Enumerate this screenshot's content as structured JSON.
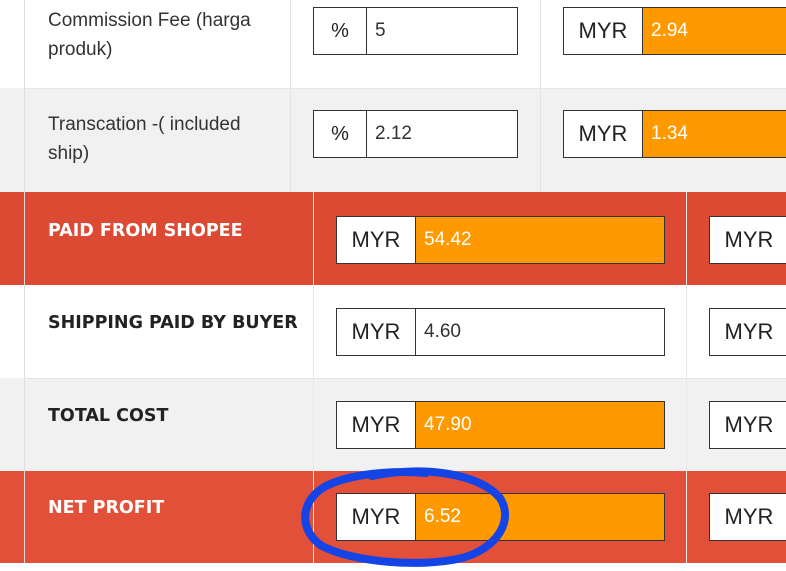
{
  "rows": {
    "commission": {
      "label": "Commission Fee (harga produk)",
      "percent_prefix": "%",
      "percent_value": "5",
      "currency": "MYR",
      "amount": "2.94"
    },
    "transaction": {
      "label": "Transcation -( included ship)",
      "percent_prefix": "%",
      "percent_value": "2.12",
      "currency": "MYR",
      "amount": "1.34"
    },
    "paid_from_shopee": {
      "label": "PAID FROM SHOPEE",
      "currency": "MYR",
      "amount": "54.42",
      "currency2": "MYR"
    },
    "shipping_paid_by_buyer": {
      "label": "SHIPPING PAID BY BUYER",
      "currency": "MYR",
      "amount": "4.60",
      "currency2": "MYR"
    },
    "total_cost": {
      "label": "TOTAL COST",
      "currency": "MYR",
      "amount": "47.90",
      "currency2": "MYR"
    },
    "net_profit": {
      "label": "NET PROFIT",
      "currency": "MYR",
      "amount": "6.52",
      "currency2": "MYR"
    }
  },
  "colors": {
    "red_row": "#dc4a34",
    "orange_field": "#ff9900",
    "light_row": "#f1f1f1",
    "highlight": "#1443e6"
  }
}
